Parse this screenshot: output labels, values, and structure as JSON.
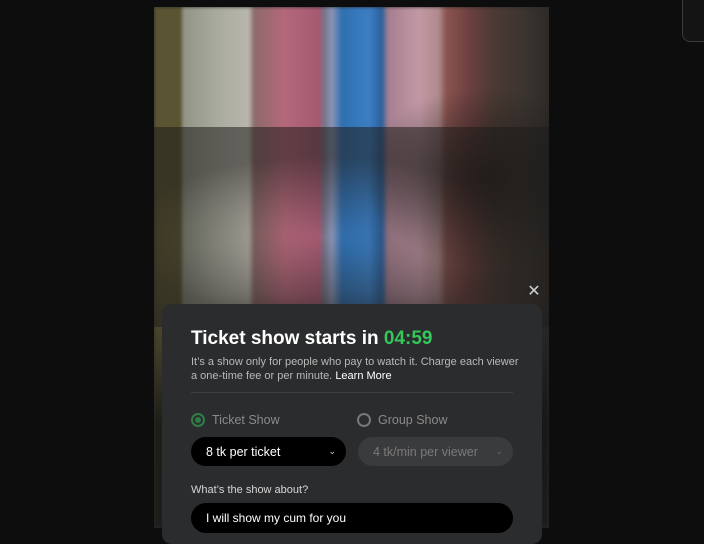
{
  "modal": {
    "title_prefix": "Ticket show starts in",
    "countdown": "04:59",
    "description": "It’s a show only for people who pay to watch it. Charge each viewer a one-time fee or per minute.",
    "learn_more": "Learn More",
    "close_icon": "close-icon"
  },
  "options": {
    "ticket_show_label": "Ticket Show",
    "ticket_show_selected": true,
    "group_show_label": "Group Show",
    "group_show_selected": false
  },
  "ticket_price": {
    "value": "8 tk per ticket"
  },
  "group_price": {
    "value": "4 tk/min per viewer"
  },
  "about": {
    "label": "What’s the show about?",
    "value": "I will show my cum for you"
  },
  "colors": {
    "accent_green": "#34c759",
    "panel_bg": "#2b2c2e"
  }
}
